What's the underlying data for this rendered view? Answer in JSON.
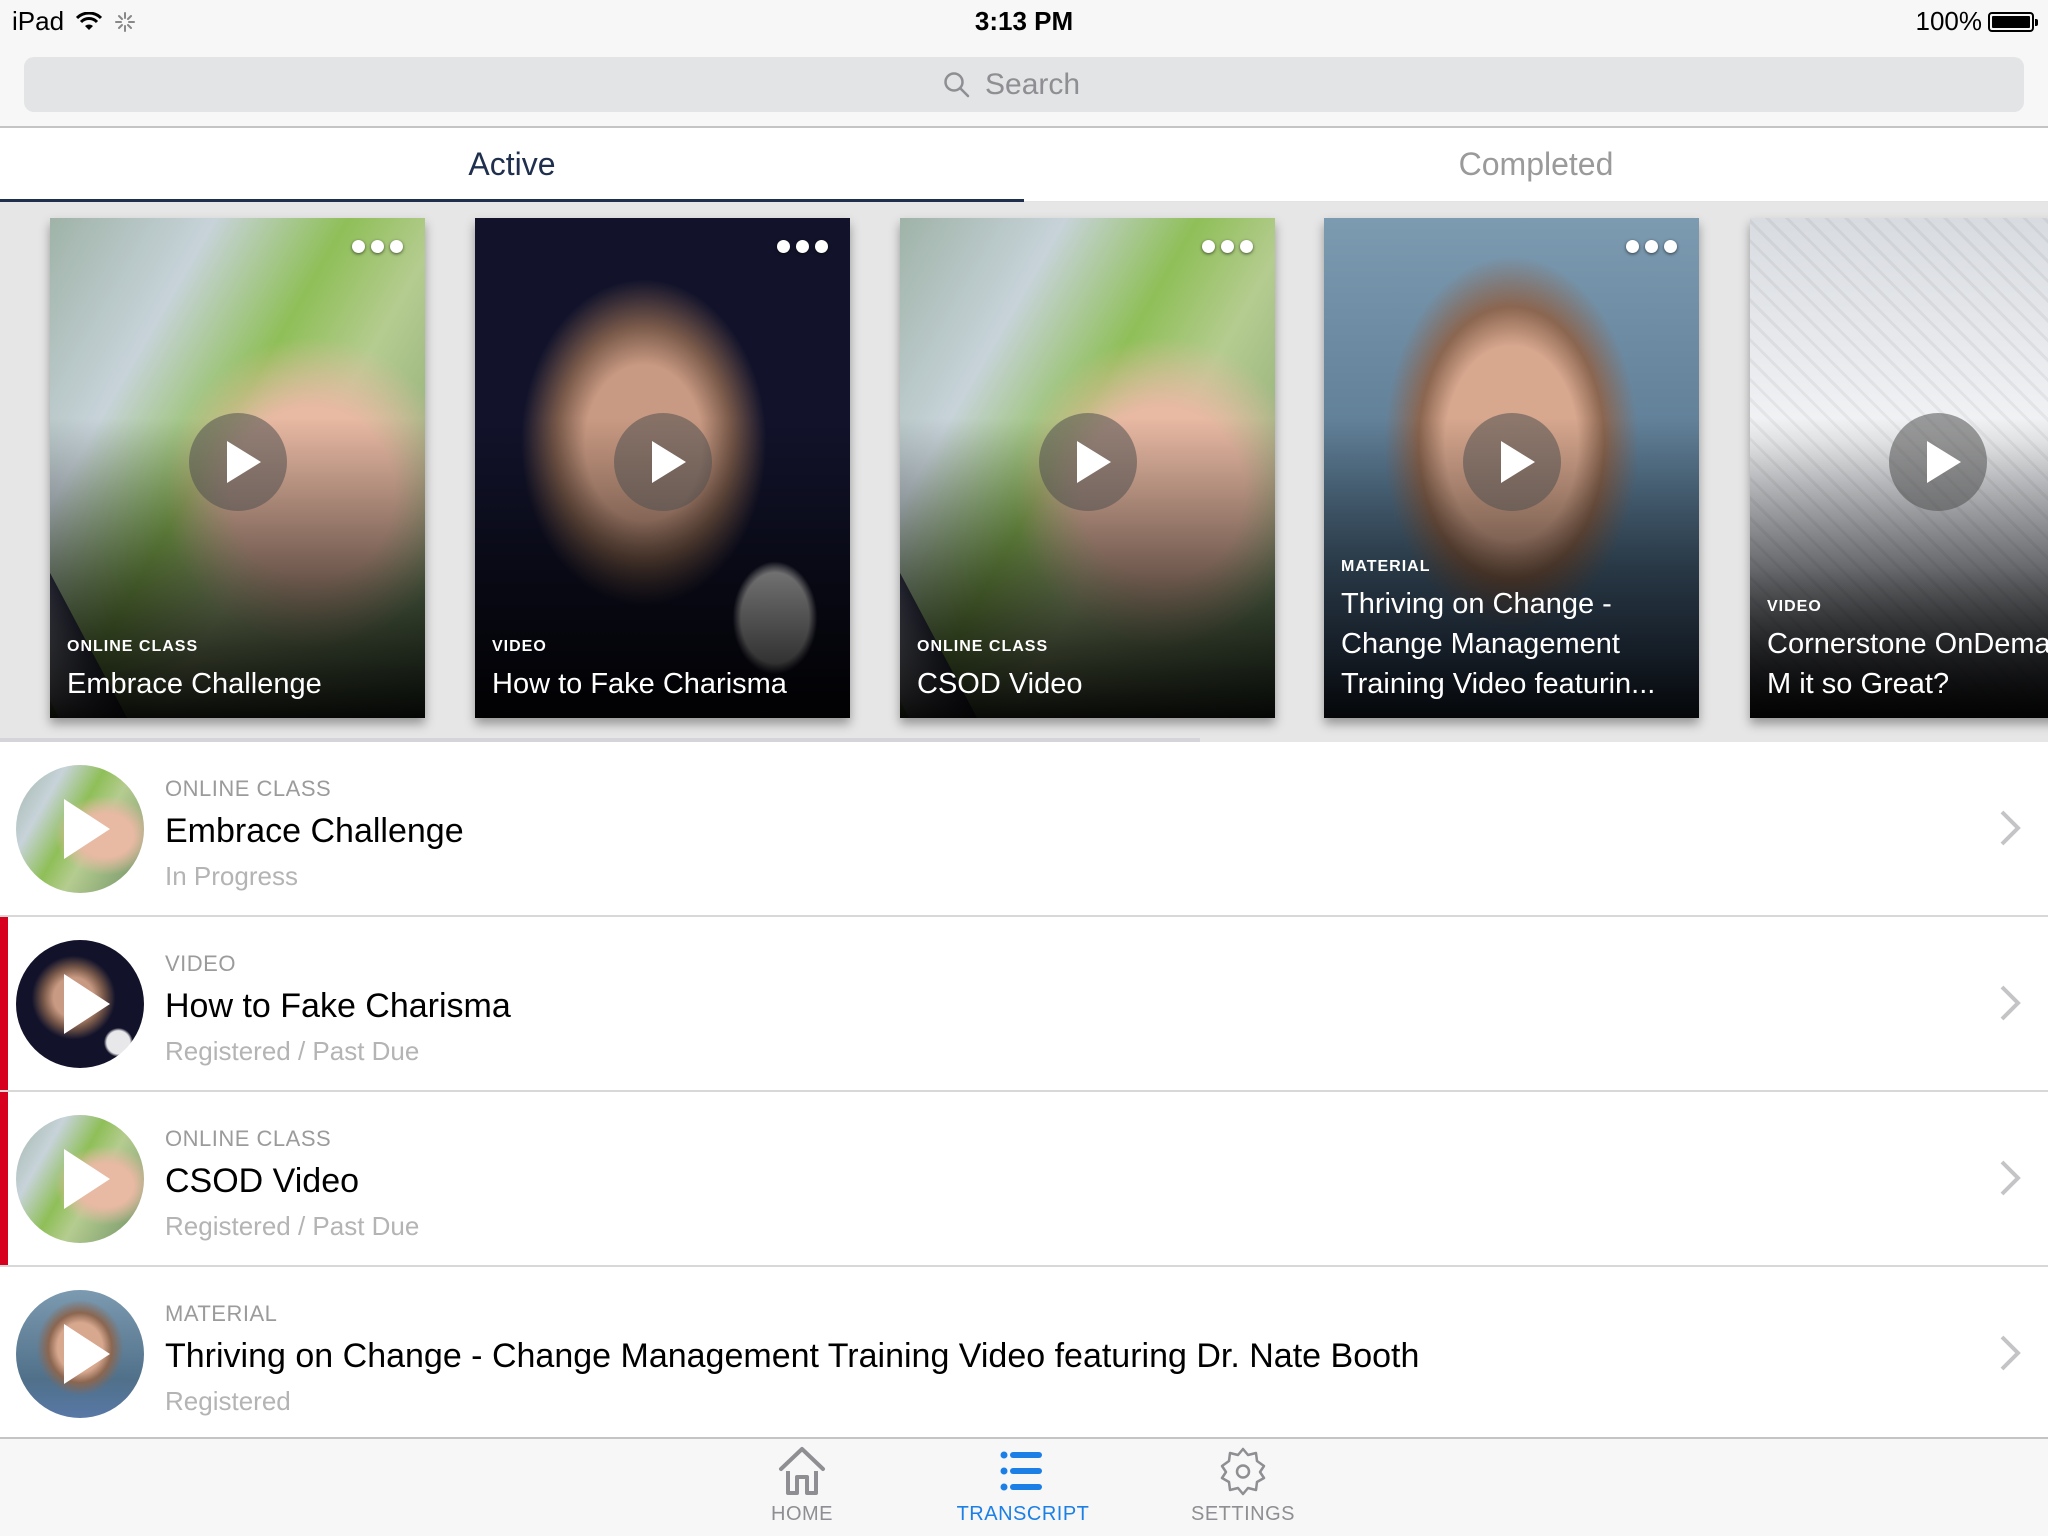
{
  "status_bar": {
    "device": "iPad",
    "time": "3:13 PM",
    "battery": "100%",
    "battery_level": 1.0
  },
  "search": {
    "placeholder": "Search",
    "value": ""
  },
  "tabs": [
    {
      "label": "Active",
      "active": true
    },
    {
      "label": "Completed",
      "active": false
    }
  ],
  "carousel": {
    "cards": [
      {
        "type": "ONLINE CLASS",
        "title": "Embrace Challenge",
        "thumbnail": "hand-tablet"
      },
      {
        "type": "VIDEO",
        "title": "How to Fake Charisma",
        "thumbnail": "presenter-phone"
      },
      {
        "type": "ONLINE CLASS",
        "title": "CSOD Video",
        "thumbnail": "hand-tablet"
      },
      {
        "type": "MATERIAL",
        "title": "Thriving on Change - Change Management Training Video featurin...",
        "thumbnail": "portrait"
      },
      {
        "type": "VIDEO",
        "title": "Cornerstone OnDemand-What M it so Great?",
        "thumbnail": "business-sketch"
      }
    ]
  },
  "list": {
    "items": [
      {
        "type": "ONLINE CLASS",
        "title": "Embrace Challenge",
        "status": "In Progress",
        "past_due": false
      },
      {
        "type": "VIDEO",
        "title": "How to Fake Charisma",
        "status": "Registered / Past Due",
        "past_due": true
      },
      {
        "type": "ONLINE CLASS",
        "title": "CSOD Video",
        "status": "Registered / Past Due",
        "past_due": true
      },
      {
        "type": "MATERIAL",
        "title": "Thriving on Change - Change Management Training Video featuring Dr. Nate Booth",
        "status": "Registered",
        "past_due": false
      }
    ]
  },
  "tab_bar": {
    "items": [
      {
        "label": "HOME",
        "icon": "home-icon",
        "active": false
      },
      {
        "label": "TRANSCRIPT",
        "icon": "list-icon",
        "active": true
      },
      {
        "label": "SETTINGS",
        "icon": "gear-icon",
        "active": false
      }
    ]
  },
  "colors": {
    "accent": "#1c7fe6",
    "active_tab": "#1f2f4d",
    "past_due": "#d7001e"
  }
}
